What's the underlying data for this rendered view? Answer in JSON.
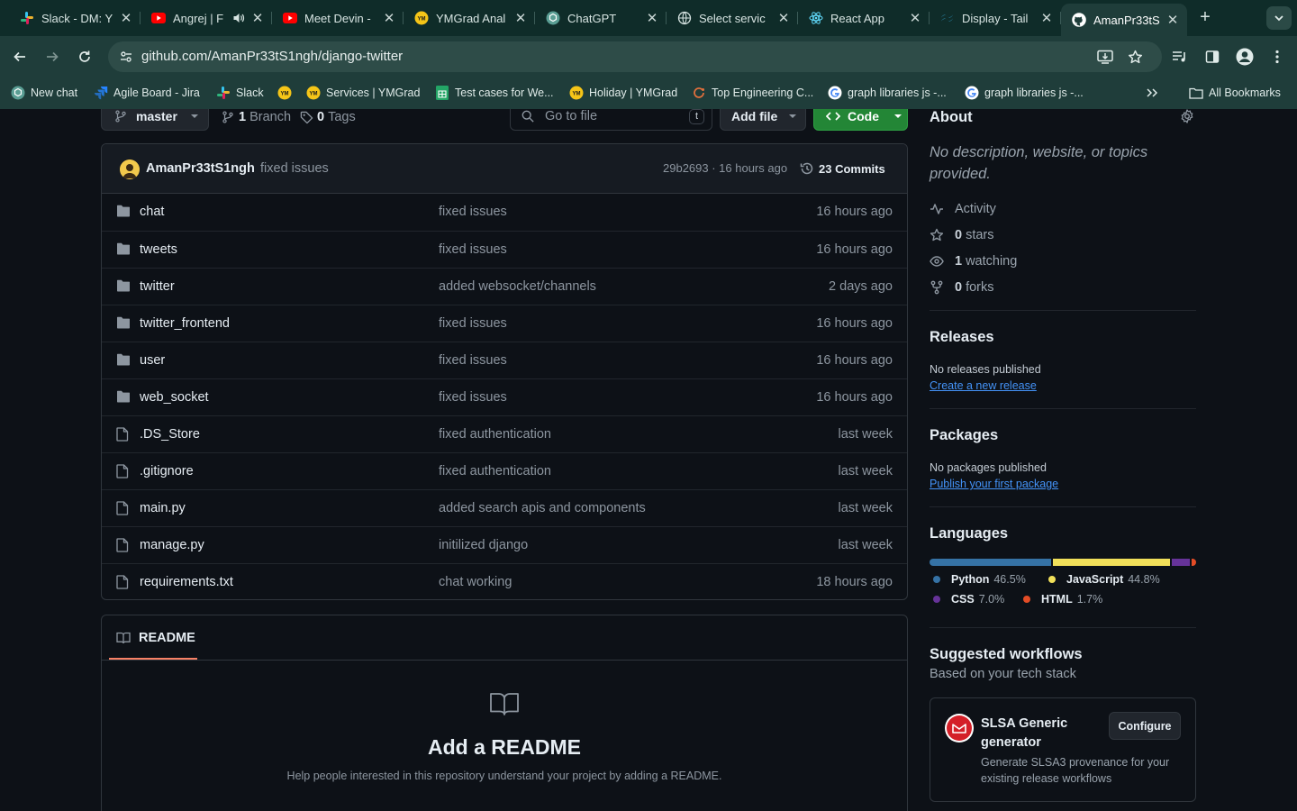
{
  "browser": {
    "tabs": [
      {
        "title": "Slack - DM: Y",
        "icon": "slack-icon"
      },
      {
        "title": "Angrej | F",
        "icon": "youtube-icon",
        "audio": true
      },
      {
        "title": "Meet Devin -",
        "icon": "youtube-icon"
      },
      {
        "title": "YMGrad Anal",
        "icon": "ymgrad-icon"
      },
      {
        "title": "ChatGPT",
        "icon": "chatgpt-icon"
      },
      {
        "title": "Select servic",
        "icon": "globe-icon"
      },
      {
        "title": "React App",
        "icon": "react-icon"
      },
      {
        "title": "Display - Tail",
        "icon": "tailwind-icon"
      },
      {
        "title": "AmanPr33tS",
        "icon": "github-icon",
        "active": true
      }
    ],
    "url": "github.com/AmanPr33tS1ngh/django-twitter",
    "bookmarks": [
      {
        "label": "New chat",
        "icon": "chatgpt-icon"
      },
      {
        "label": "Agile Board - Jira",
        "icon": "jira-icon"
      },
      {
        "label": "Slack",
        "icon": "slack-icon"
      },
      {
        "label": "",
        "icon": "ymgrad-icon"
      },
      {
        "label": "Services | YMGrad",
        "icon": "ymgrad-icon"
      },
      {
        "label": "Test cases for We...",
        "icon": "sheets-icon"
      },
      {
        "label": "Holiday | YMGrad",
        "icon": "ymgrad-icon"
      },
      {
        "label": "Top Engineering C...",
        "icon": "loop-icon"
      },
      {
        "label": "graph libraries js -...",
        "icon": "google-icon"
      },
      {
        "label": "graph libraries js -...",
        "icon": "google-icon"
      }
    ],
    "all_bookmarks": "All Bookmarks"
  },
  "repo": {
    "branch": "master",
    "branch_count": "1",
    "branch_label": "Branch",
    "tag_count": "0",
    "tag_label": "Tags",
    "go_to_file": "Go to file",
    "go_to_file_key": "t",
    "add_file": "Add file",
    "code": "Code",
    "commit": {
      "author": "AmanPr33tS1ngh",
      "message": "fixed issues",
      "hash_time": "29b2693 · 16 hours ago",
      "commits": "23 Commits"
    },
    "files": [
      {
        "name": "chat",
        "type": "dir",
        "message": "fixed issues",
        "time": "16 hours ago"
      },
      {
        "name": "tweets",
        "type": "dir",
        "message": "fixed issues",
        "time": "16 hours ago"
      },
      {
        "name": "twitter",
        "type": "dir",
        "message": "added websocket/channels",
        "time": "2 days ago"
      },
      {
        "name": "twitter_frontend",
        "type": "dir",
        "message": "fixed issues",
        "time": "16 hours ago"
      },
      {
        "name": "user",
        "type": "dir",
        "message": "fixed issues",
        "time": "16 hours ago"
      },
      {
        "name": "web_socket",
        "type": "dir",
        "message": "fixed issues",
        "time": "16 hours ago"
      },
      {
        "name": ".DS_Store",
        "type": "file",
        "message": "fixed authentication",
        "time": "last week"
      },
      {
        "name": ".gitignore",
        "type": "file",
        "message": "fixed authentication",
        "time": "last week"
      },
      {
        "name": "main.py",
        "type": "file",
        "message": "added search apis and components",
        "time": "last week"
      },
      {
        "name": "manage.py",
        "type": "file",
        "message": "initilized django",
        "time": "last week"
      },
      {
        "name": "requirements.txt",
        "type": "file",
        "message": "chat working",
        "time": "18 hours ago"
      }
    ],
    "readme": {
      "tab": "README",
      "title": "Add a README",
      "desc": "Help people interested in this repository understand your project by adding a README."
    }
  },
  "about": {
    "heading": "About",
    "description": "No description, website, or topics provided.",
    "activity": "Activity",
    "stars_count": "0",
    "stars_label": "stars",
    "watching_count": "1",
    "watching_label": "watching",
    "forks_count": "0",
    "forks_label": "forks"
  },
  "releases": {
    "heading": "Releases",
    "none": "No releases published",
    "link": "Create a new release"
  },
  "packages": {
    "heading": "Packages",
    "none": "No packages published",
    "link": "Publish your first package"
  },
  "languages": {
    "heading": "Languages",
    "items": [
      {
        "name": "Python",
        "percent": "46.5%",
        "value": 46.5,
        "color": "#3572A5"
      },
      {
        "name": "JavaScript",
        "percent": "44.8%",
        "value": 44.8,
        "color": "#f1e05a"
      },
      {
        "name": "CSS",
        "percent": "7.0%",
        "value": 7.0,
        "color": "#663399"
      },
      {
        "name": "HTML",
        "percent": "1.7%",
        "value": 1.7,
        "color": "#e34c26"
      }
    ]
  },
  "workflows": {
    "heading": "Suggested workflows",
    "sub": "Based on your tech stack",
    "card": {
      "title": "SLSA Generic generator",
      "desc": "Generate SLSA3 provenance for your existing release workflows",
      "button": "Configure"
    }
  }
}
